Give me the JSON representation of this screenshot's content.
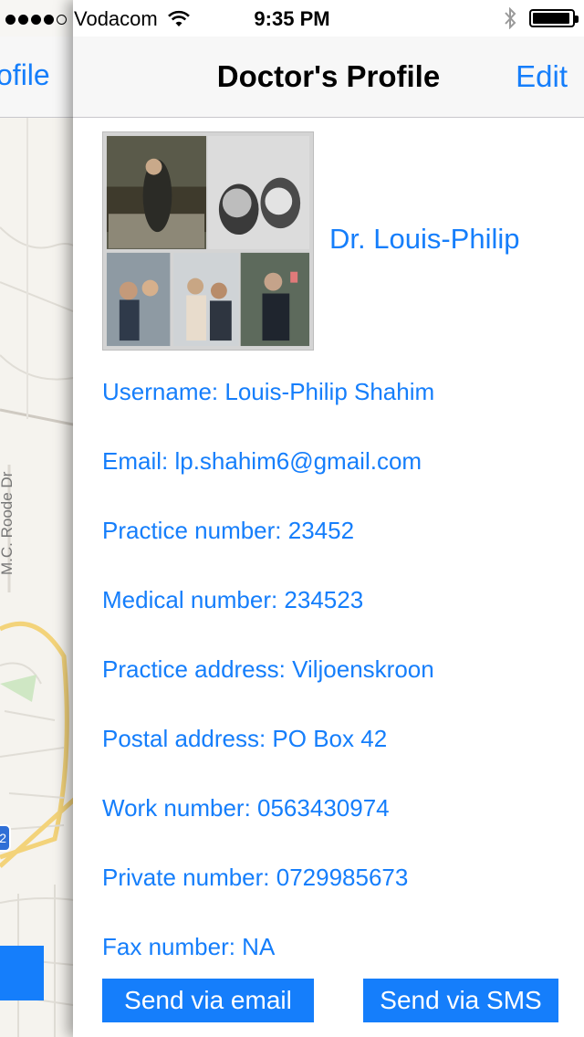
{
  "status_bar": {
    "carrier": "Vodacom",
    "time": "9:35 PM",
    "signal_bars": 4,
    "signal_total": 5,
    "battery_level": 0.85
  },
  "back_panel": {
    "back_label": "ofile",
    "street_label": "M.C. Roode Dr",
    "route_badge": "2"
  },
  "navbar": {
    "title": "Doctor's Profile",
    "edit_label": "Edit"
  },
  "profile": {
    "name": "Dr. Louis-Philip",
    "fields": [
      {
        "label": "Username: Louis-Philip Shahim"
      },
      {
        "label": "Email: lp.shahim6@gmail.com"
      },
      {
        "label": "Practice number: 23452"
      },
      {
        "label": "Medical number: 234523"
      },
      {
        "label": "Practice address: Viljoenskroon"
      },
      {
        "label": "Postal address: PO Box 42"
      },
      {
        "label": "Work number: 0563430974"
      },
      {
        "label": "Private number: 0729985673"
      },
      {
        "label": "Fax number: NA"
      }
    ]
  },
  "actions": {
    "email_label": "Send via email",
    "sms_label": "Send via SMS"
  },
  "colors": {
    "accent": "#157efb",
    "navbar_bg": "#f7f7f7",
    "map_bg": "#f7f6f3"
  }
}
